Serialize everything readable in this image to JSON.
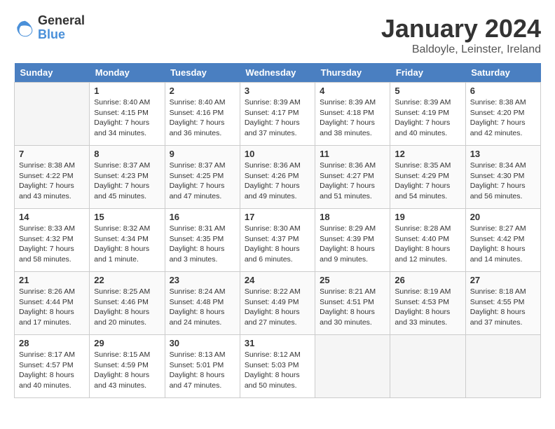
{
  "logo": {
    "general": "General",
    "blue": "Blue"
  },
  "title": "January 2024",
  "subtitle": "Baldoyle, Leinster, Ireland",
  "days_of_week": [
    "Sunday",
    "Monday",
    "Tuesday",
    "Wednesday",
    "Thursday",
    "Friday",
    "Saturday"
  ],
  "weeks": [
    [
      {
        "day": "",
        "empty": true
      },
      {
        "day": "1",
        "sunrise": "Sunrise: 8:40 AM",
        "sunset": "Sunset: 4:15 PM",
        "daylight": "Daylight: 7 hours and 34 minutes."
      },
      {
        "day": "2",
        "sunrise": "Sunrise: 8:40 AM",
        "sunset": "Sunset: 4:16 PM",
        "daylight": "Daylight: 7 hours and 36 minutes."
      },
      {
        "day": "3",
        "sunrise": "Sunrise: 8:39 AM",
        "sunset": "Sunset: 4:17 PM",
        "daylight": "Daylight: 7 hours and 37 minutes."
      },
      {
        "day": "4",
        "sunrise": "Sunrise: 8:39 AM",
        "sunset": "Sunset: 4:18 PM",
        "daylight": "Daylight: 7 hours and 38 minutes."
      },
      {
        "day": "5",
        "sunrise": "Sunrise: 8:39 AM",
        "sunset": "Sunset: 4:19 PM",
        "daylight": "Daylight: 7 hours and 40 minutes."
      },
      {
        "day": "6",
        "sunrise": "Sunrise: 8:38 AM",
        "sunset": "Sunset: 4:20 PM",
        "daylight": "Daylight: 7 hours and 42 minutes."
      }
    ],
    [
      {
        "day": "7",
        "sunrise": "Sunrise: 8:38 AM",
        "sunset": "Sunset: 4:22 PM",
        "daylight": "Daylight: 7 hours and 43 minutes."
      },
      {
        "day": "8",
        "sunrise": "Sunrise: 8:37 AM",
        "sunset": "Sunset: 4:23 PM",
        "daylight": "Daylight: 7 hours and 45 minutes."
      },
      {
        "day": "9",
        "sunrise": "Sunrise: 8:37 AM",
        "sunset": "Sunset: 4:25 PM",
        "daylight": "Daylight: 7 hours and 47 minutes."
      },
      {
        "day": "10",
        "sunrise": "Sunrise: 8:36 AM",
        "sunset": "Sunset: 4:26 PM",
        "daylight": "Daylight: 7 hours and 49 minutes."
      },
      {
        "day": "11",
        "sunrise": "Sunrise: 8:36 AM",
        "sunset": "Sunset: 4:27 PM",
        "daylight": "Daylight: 7 hours and 51 minutes."
      },
      {
        "day": "12",
        "sunrise": "Sunrise: 8:35 AM",
        "sunset": "Sunset: 4:29 PM",
        "daylight": "Daylight: 7 hours and 54 minutes."
      },
      {
        "day": "13",
        "sunrise": "Sunrise: 8:34 AM",
        "sunset": "Sunset: 4:30 PM",
        "daylight": "Daylight: 7 hours and 56 minutes."
      }
    ],
    [
      {
        "day": "14",
        "sunrise": "Sunrise: 8:33 AM",
        "sunset": "Sunset: 4:32 PM",
        "daylight": "Daylight: 7 hours and 58 minutes."
      },
      {
        "day": "15",
        "sunrise": "Sunrise: 8:32 AM",
        "sunset": "Sunset: 4:34 PM",
        "daylight": "Daylight: 8 hours and 1 minute."
      },
      {
        "day": "16",
        "sunrise": "Sunrise: 8:31 AM",
        "sunset": "Sunset: 4:35 PM",
        "daylight": "Daylight: 8 hours and 3 minutes."
      },
      {
        "day": "17",
        "sunrise": "Sunrise: 8:30 AM",
        "sunset": "Sunset: 4:37 PM",
        "daylight": "Daylight: 8 hours and 6 minutes."
      },
      {
        "day": "18",
        "sunrise": "Sunrise: 8:29 AM",
        "sunset": "Sunset: 4:39 PM",
        "daylight": "Daylight: 8 hours and 9 minutes."
      },
      {
        "day": "19",
        "sunrise": "Sunrise: 8:28 AM",
        "sunset": "Sunset: 4:40 PM",
        "daylight": "Daylight: 8 hours and 12 minutes."
      },
      {
        "day": "20",
        "sunrise": "Sunrise: 8:27 AM",
        "sunset": "Sunset: 4:42 PM",
        "daylight": "Daylight: 8 hours and 14 minutes."
      }
    ],
    [
      {
        "day": "21",
        "sunrise": "Sunrise: 8:26 AM",
        "sunset": "Sunset: 4:44 PM",
        "daylight": "Daylight: 8 hours and 17 minutes."
      },
      {
        "day": "22",
        "sunrise": "Sunrise: 8:25 AM",
        "sunset": "Sunset: 4:46 PM",
        "daylight": "Daylight: 8 hours and 20 minutes."
      },
      {
        "day": "23",
        "sunrise": "Sunrise: 8:24 AM",
        "sunset": "Sunset: 4:48 PM",
        "daylight": "Daylight: 8 hours and 24 minutes."
      },
      {
        "day": "24",
        "sunrise": "Sunrise: 8:22 AM",
        "sunset": "Sunset: 4:49 PM",
        "daylight": "Daylight: 8 hours and 27 minutes."
      },
      {
        "day": "25",
        "sunrise": "Sunrise: 8:21 AM",
        "sunset": "Sunset: 4:51 PM",
        "daylight": "Daylight: 8 hours and 30 minutes."
      },
      {
        "day": "26",
        "sunrise": "Sunrise: 8:19 AM",
        "sunset": "Sunset: 4:53 PM",
        "daylight": "Daylight: 8 hours and 33 minutes."
      },
      {
        "day": "27",
        "sunrise": "Sunrise: 8:18 AM",
        "sunset": "Sunset: 4:55 PM",
        "daylight": "Daylight: 8 hours and 37 minutes."
      }
    ],
    [
      {
        "day": "28",
        "sunrise": "Sunrise: 8:17 AM",
        "sunset": "Sunset: 4:57 PM",
        "daylight": "Daylight: 8 hours and 40 minutes."
      },
      {
        "day": "29",
        "sunrise": "Sunrise: 8:15 AM",
        "sunset": "Sunset: 4:59 PM",
        "daylight": "Daylight: 8 hours and 43 minutes."
      },
      {
        "day": "30",
        "sunrise": "Sunrise: 8:13 AM",
        "sunset": "Sunset: 5:01 PM",
        "daylight": "Daylight: 8 hours and 47 minutes."
      },
      {
        "day": "31",
        "sunrise": "Sunrise: 8:12 AM",
        "sunset": "Sunset: 5:03 PM",
        "daylight": "Daylight: 8 hours and 50 minutes."
      },
      {
        "day": "",
        "empty": true
      },
      {
        "day": "",
        "empty": true
      },
      {
        "day": "",
        "empty": true
      }
    ]
  ]
}
